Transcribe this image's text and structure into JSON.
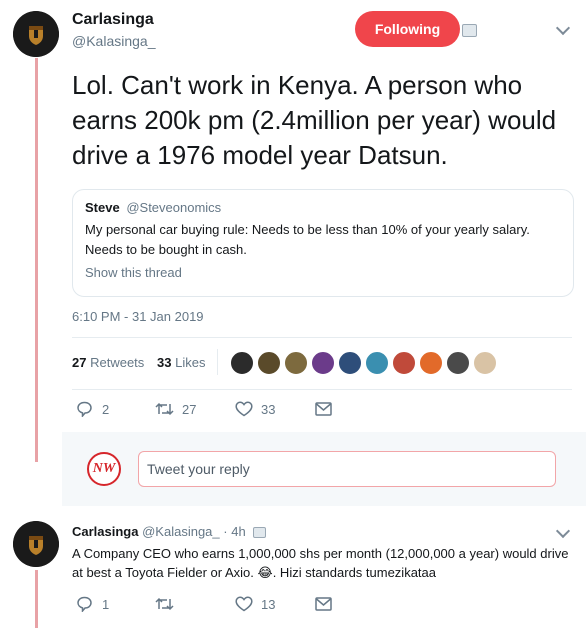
{
  "tweet": {
    "author_name": "Carlasinga",
    "author_handle": "@Kalasinga_",
    "follow_label": "Following",
    "text": "Lol. Can't work in Kenya. A person who earns 200k pm (2.4million per year) would drive a 1976 model year Datsun.",
    "timestamp": "6:10 PM - 31 Jan 2019",
    "retweets_count": "27",
    "retweets_label": "Retweets",
    "likes_count": "33",
    "likes_label": "Likes",
    "actions": {
      "replies": "2",
      "retweets": "27",
      "likes": "33"
    }
  },
  "quote": {
    "author_name": "Steve",
    "author_handle": "@Steveonomics",
    "text": "My personal car buying rule: Needs to be less than 10% of your yearly salary. Needs to be bought in cash.",
    "link": "Show this thread"
  },
  "reply_box": {
    "avatar_text": "NW",
    "placeholder": "Tweet your reply"
  },
  "reply": {
    "author_name": "Carlasinga",
    "author_handle": "@Kalasinga_",
    "dot": "·",
    "time": "4h",
    "text_before_emoji": "A Company CEO who earns 1,000,000 shs per month (12,000,000 a year) would drive at best a Toyota Fielder or Axio.",
    "emoji": "😂",
    "text_after_emoji": ". Hizi standards tumezikataa",
    "actions": {
      "replies": "1",
      "retweets": "",
      "likes": "13"
    }
  },
  "colors": {
    "accent": "#f0454b",
    "thread_line": "#e8a2a6",
    "muted_text": "#657786",
    "link_blue": "#1da1f2"
  }
}
